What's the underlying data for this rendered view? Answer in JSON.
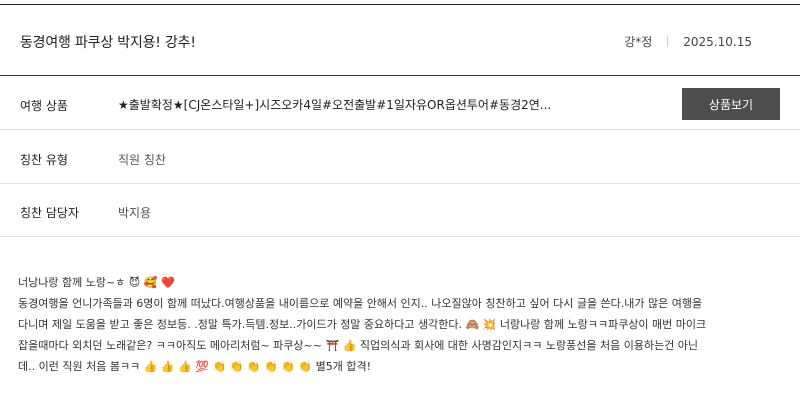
{
  "review": {
    "title": "동경여행 파쿠상 박지용! 강추!",
    "author": "강*정",
    "date": "2025.10.15"
  },
  "details": {
    "product_label": "여행 상품",
    "product_value": "★출발확정★[CJ온스타일+]시즈오카4일#오전출발#1일자유OR옵션투어#동경2연...",
    "product_button": "상품보기",
    "type_label": "칭찬 유형",
    "type_value": "직원 칭찬",
    "staff_label": "칭찬 담당자",
    "staff_value": "박지용"
  },
  "body_lines": [
    "너낭나랑 함께 노랑~ㅎ 😈 🥰 ❤️",
    "동경여행을 언니가족들과 6명이 함께 떠났다.여행상품을 내이름으로 예약을 안해서 인지.. 나오질않아 칭찬하고 싶어 다시 글을 쓴다.내가 많은 여행을",
    "다니며 제일 도움을 받고 좋은 정보등. .정말 특가.득템.정보..가이드가 정말 중요하다고 생각한다. 🙈 💥 너랑나랑 함께 노랑ㅋㅋ파쿠상이 매번 마이크",
    "잡을때마다 외치던 노래같은? ㅋㅋ아직도 메아리처럼~ 파쿠상~~ ⛩️ 👍 직업의식과 회사에 대한 사명감인지ㅋㅋ 노랑풍선을 처음 이용하는건 아닌",
    "데.. 이런 직원 처음 봄ㅋㅋ 👍 👍 👍 💯 👏 👏 👏 👏 👏 👏 별5개 합격!"
  ]
}
